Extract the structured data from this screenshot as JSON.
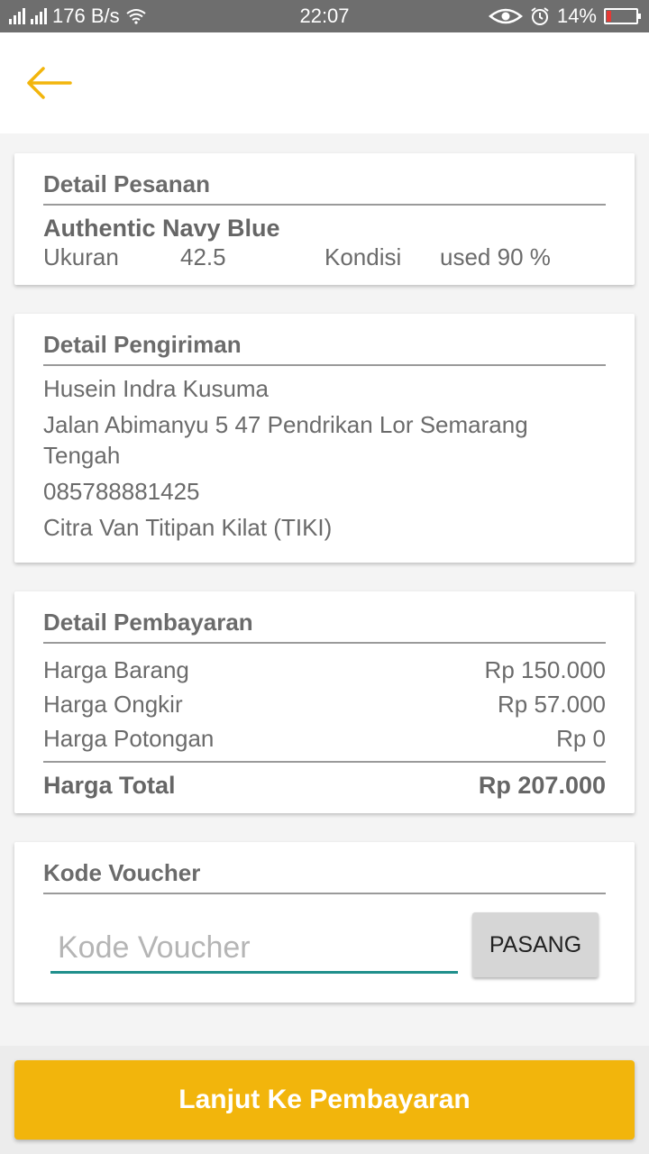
{
  "status_bar": {
    "net_speed": "176 B/s",
    "time": "22:07",
    "battery": "14%",
    "icons": [
      "signal-icon",
      "wifi-icon",
      "eye-icon",
      "alarm-icon",
      "battery-icon"
    ]
  },
  "app_bar": {
    "back_icon": "arrow-left-icon",
    "accent": "#f2b50c"
  },
  "order": {
    "title": "Detail Pesanan",
    "product_name": "Authentic Navy Blue",
    "size_label": "Ukuran",
    "size_value": "42.5",
    "condition_label": "Kondisi",
    "condition_value": "used 90 %"
  },
  "shipping": {
    "title": "Detail Pengiriman",
    "name": "Husein Indra Kusuma",
    "address_line1": "Jalan Abimanyu 5 47 Pendrikan Lor Semarang",
    "address_line2": "Tengah",
    "phone": "085788881425",
    "courier": "Citra Van Titipan Kilat (TIKI)"
  },
  "payment": {
    "title": "Detail Pembayaran",
    "rows": [
      {
        "label": "Harga Barang",
        "value": "Rp 150.000"
      },
      {
        "label": "Harga Ongkir",
        "value": "Rp 57.000"
      },
      {
        "label": "Harga Potongan",
        "value": "Rp 0"
      }
    ],
    "total_label": "Harga Total",
    "total_value": "Rp 207.000"
  },
  "voucher": {
    "title": "Kode Voucher",
    "placeholder": "Kode Voucher",
    "value": "",
    "apply_label": "PASANG"
  },
  "cta": {
    "label": "Lanjut Ke Pembayaran",
    "color": "#f2b50c"
  }
}
